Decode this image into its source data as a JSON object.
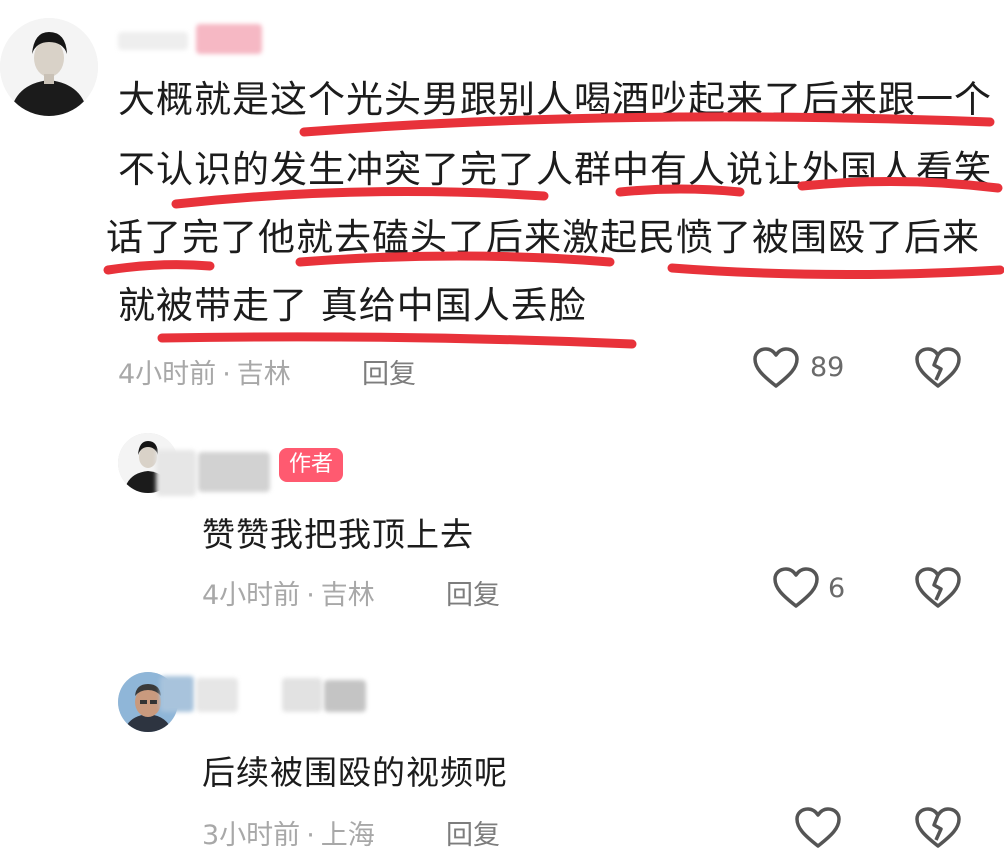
{
  "comments": [
    {
      "lines": [
        "大概就是这个光头男跟别人喝酒吵起来了后来跟一个",
        "不认识的发生冲突了完了人群中有人说让外国人看笑",
        "话了完了他就去磕头了后来激起民愤了被围殴了后来",
        "就被带走了 真给中国人丢脸"
      ],
      "time": "4小时前",
      "location": "吉林",
      "reply_label": "回复",
      "likes": "89"
    }
  ],
  "replies": [
    {
      "badge": "作者",
      "text": "赞赞我把我顶上去",
      "time": "4小时前",
      "location": "吉林",
      "reply_label": "回复",
      "likes": "6"
    },
    {
      "text": "后续被围殴的视频呢",
      "time": "3小时前",
      "location": "上海",
      "reply_label": "回复",
      "likes": ""
    }
  ],
  "meta_separator": "·",
  "colors": {
    "annotation": "#e8323a",
    "badge": "#ff5a70",
    "meta": "#a8a8a8"
  },
  "icons": [
    "heart-icon",
    "broken-heart-icon"
  ]
}
